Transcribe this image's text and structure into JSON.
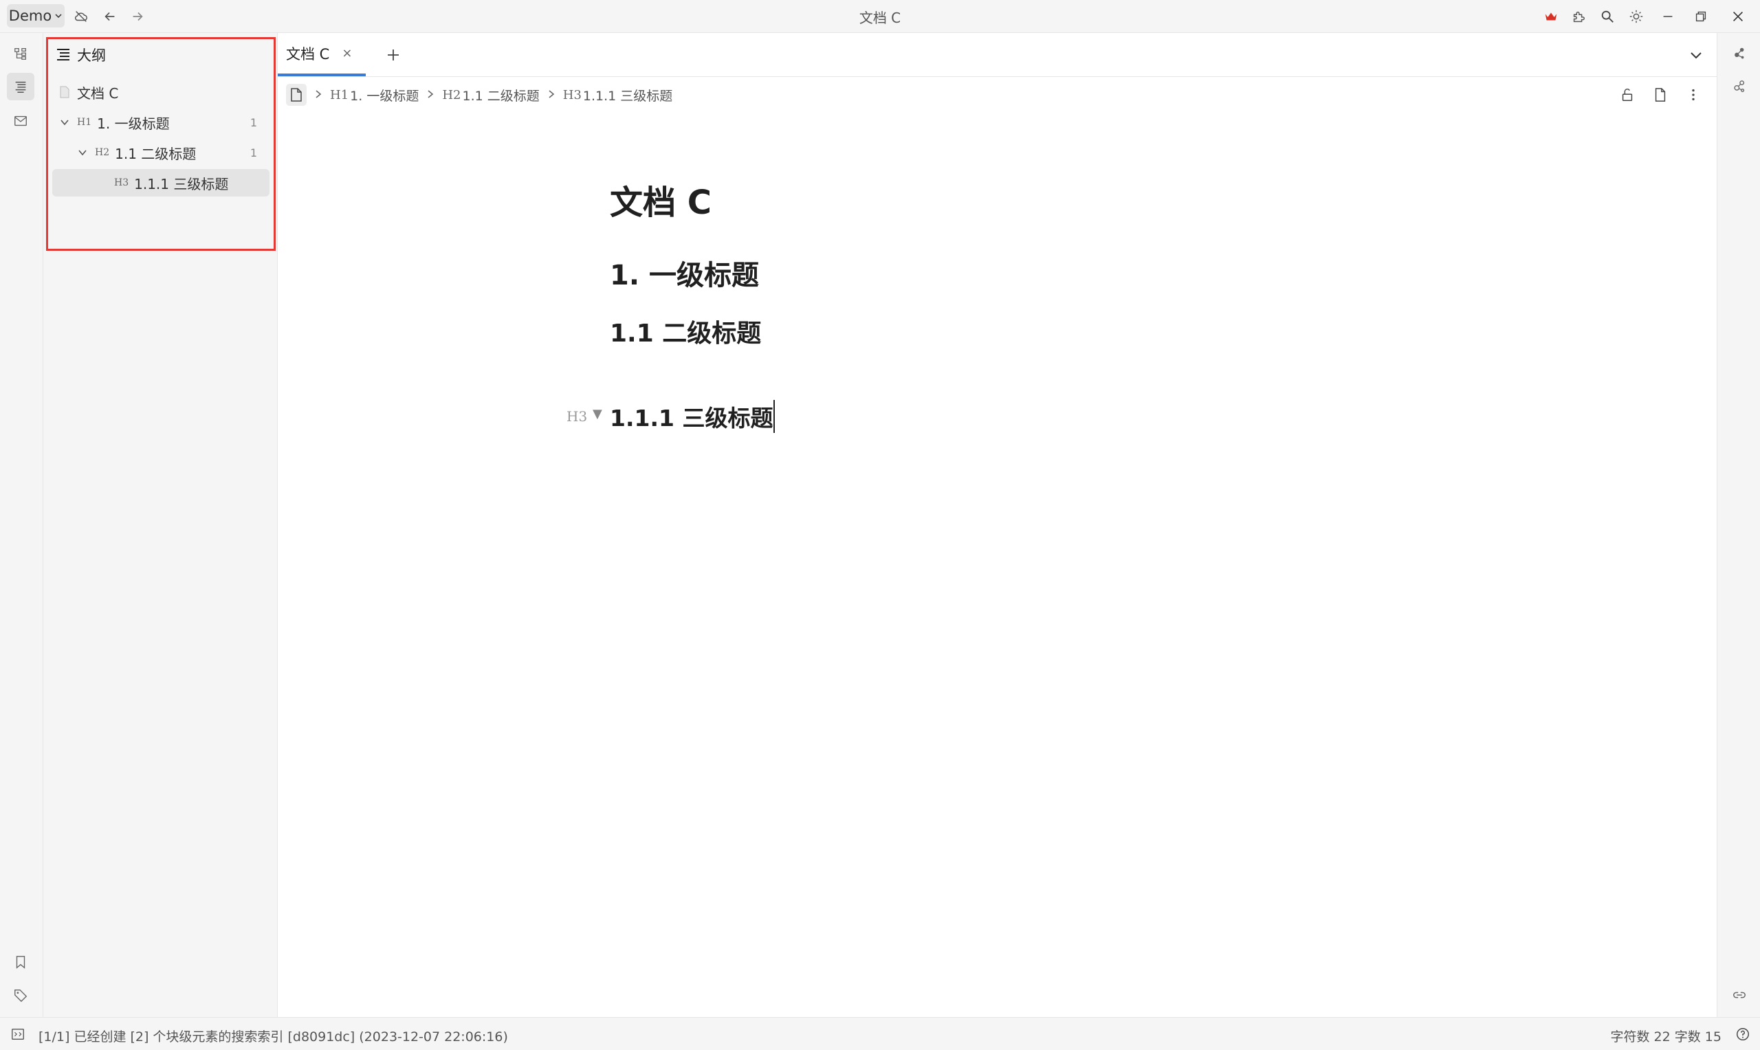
{
  "titlebar": {
    "workspace": "Demo",
    "window_title": "文档 C"
  },
  "outline": {
    "header": "大纲",
    "root": "文档 C",
    "items": [
      {
        "tag": "H1",
        "label": "1. 一级标题",
        "count": "1"
      },
      {
        "tag": "H2",
        "label": "1.1 二级标题",
        "count": "1"
      },
      {
        "tag": "H3",
        "label": "1.1.1 三级标题"
      }
    ]
  },
  "tabs": [
    {
      "label": "文档 C",
      "close": "×"
    }
  ],
  "breadcrumb": [
    {
      "tag": "H1",
      "label": "1. 一级标题"
    },
    {
      "tag": "H2",
      "label": "1.1 二级标题"
    },
    {
      "tag": "H3",
      "label": "1.1.1 三级标题"
    }
  ],
  "document": {
    "title": "文档 C",
    "h1": "1. 一级标题",
    "h2": "1.1 二级标题",
    "h3": "1.1.1 三级标题",
    "h3_marker": "H3",
    "caret": "▼"
  },
  "statusbar": {
    "message": "[1/1] 已经创建 [2] 个块级元素的搜索索引 [d8091dc] (2023-12-07 22:06:16)",
    "counts": "字符数 22  字数 15"
  },
  "colors": {
    "accent": "#3a7bd5",
    "highlight_border": "#e53935",
    "crown": "#d93025"
  }
}
